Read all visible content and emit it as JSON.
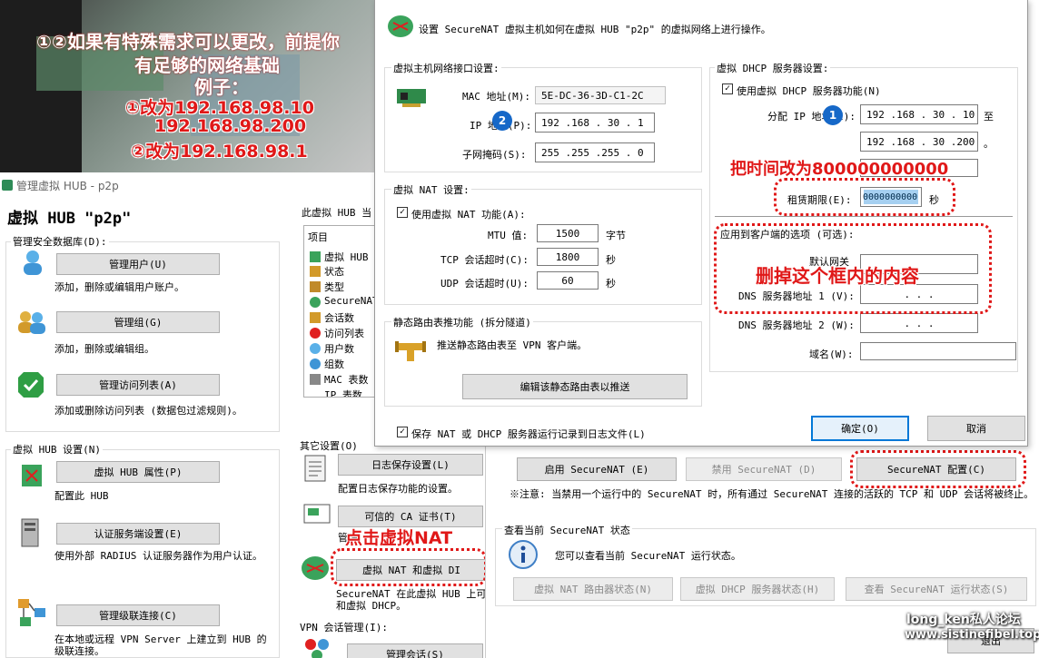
{
  "colors": {
    "accent": "#0078d7",
    "annotation": "#e01818",
    "badge": "#1668c8"
  },
  "overlay": {
    "line1": "①②如果有特殊需求可以更改，前提你",
    "line2": "有足够的网络基础",
    "line3": "例子：",
    "line4": "①改为192.168.98.10",
    "line5": "192.168.98.200",
    "line6": "②改为192.168.98.1"
  },
  "annotations": {
    "lease": "把时间改为800000000000",
    "delete": "删掉这个框内的内容",
    "click_nat": "点击虚拟NAT"
  },
  "badges": {
    "one": "1",
    "two": "2"
  },
  "manager": {
    "window_title": "管理虚拟 HUB - p2p",
    "hub_title": "虚拟 HUB \"p2p\"",
    "db_group": "管理安全数据库(D):",
    "manage_users": "管理用户(U)",
    "manage_users_desc": "添加，删除或编辑用户账户。",
    "manage_groups": "管理组(G)",
    "manage_groups_desc": "添加，删除或编辑组。",
    "manage_acl": "管理访问列表(A)",
    "manage_acl_desc": "添加或删除访问列表 (数据包过滤规则)。",
    "hub_settings_group": "虚拟 HUB 设置(N)",
    "hub_props": "虚拟 HUB 属性(P)",
    "hub_props_desc": "配置此 HUB",
    "auth_server": "认证服务端设置(E)",
    "auth_server_desc": "使用外部 RADIUS 认证服务器作为用户认证。",
    "cascade": "管理级联连接(C)",
    "cascade_desc": "在本地或远程 VPN Server 上建立到 HUB 的级联连接。",
    "status_group": "此虚拟 HUB 当",
    "status_header": "项目",
    "status_items": [
      "虚拟 HUB",
      "状态",
      "类型",
      "SecureNAT",
      "会话数",
      "访问列表",
      "用户数",
      "组数",
      "MAC 表数",
      "IP 表数"
    ],
    "other_group": "其它设置(O)",
    "log_save": "日志保存设置(L)",
    "log_save_desc": "配置日志保存功能的设置。",
    "ca_cert": "可信的 CA 证书(T)",
    "ca_cert_desc": "管理",
    "nat_btn": "虚拟 NAT 和虚拟 DI",
    "nat_desc1": "SecureNAT 在此虚拟 HUB 上可",
    "nat_desc2": "和虚拟 DHCP。",
    "vpn_group": "VPN 会话管理(I):",
    "manage_sessions": "管理会话(S)"
  },
  "nat_panel": {
    "enable": "启用 SecureNAT (E)",
    "disable": "禁用 SecureNAT (D)",
    "config": "SecureNAT 配置(C)",
    "note": "※注意: 当禁用一个运行中的 SecureNAT 时，所有通过 SecureNAT 连接的活跃的 TCP 和 UDP 会话将被终止。",
    "status_group": "查看当前 SecureNAT 状态",
    "status_desc": "您可以查看当前 SecureNAT 运行状态。",
    "nat_router": "虚拟 NAT 路由器状态(N)",
    "dhcp_status": "虚拟 DHCP 服务器状态(H)",
    "run_status": "查看 SecureNAT 运行状态(S)",
    "exit": "退出"
  },
  "dialog": {
    "header": "设置 SecureNAT 虚拟主机如何在虚拟 HUB \"p2p\" 的虚拟网络上进行操作。",
    "iface_group": "虚拟主机网络接口设置:",
    "mac_label": "MAC 地址(M):",
    "mac_value": "5E-DC-36-3D-C1-2C",
    "ip_label": "IP 地址(P):",
    "ip_value": "192 .168 . 30 . 1",
    "mask_label": "子网掩码(S):",
    "mask_value": "255 .255 .255 . 0",
    "nat_group": "虚拟 NAT 设置:",
    "nat_enable": "使用虚拟 NAT 功能(A):",
    "mtu_label": "MTU 值:",
    "mtu_value": "1500",
    "mtu_unit": "字节",
    "tcp_label": "TCP 会话超时(C):",
    "tcp_value": "1800",
    "tcp_unit": "秒",
    "udp_label": "UDP 会话超时(U):",
    "udp_value": "60",
    "udp_unit": "秒",
    "route_group": "静态路由表推功能 (拆分隧道)",
    "route_desc": "推送静态路由表至 VPN 客户端。",
    "route_btn": "编辑该静态路由表以推送",
    "log_chk": "保存 NAT 或 DHCP 服务器运行记录到日志文件(L)",
    "dhcp_group": "虚拟 DHCP 服务器设置:",
    "dhcp_enable": "使用虚拟 DHCP 服务器功能(N)",
    "alloc_label": "分配 IP 地址(I):",
    "alloc_start": "192 .168 . 30 . 10",
    "to": "至",
    "alloc_end": "192 .168 . 30 .200",
    "end_mark": "。",
    "lease_label": "租赁期限(E):",
    "lease_value": "0000000000",
    "lease_unit": "秒",
    "client_group": "应用到客户端的选项 (可选):",
    "gateway_label": "默认网关",
    "dns1_label": "DNS 服务器地址 1 (V):",
    "dns1_value": ".   .   .",
    "dns2_label": "DNS 服务器地址 2 (W):",
    "dns2_value": ".   .   .",
    "domain_label": "域名(W):",
    "ok": "确定(O)",
    "cancel": "取消"
  },
  "watermark": {
    "line1": "long_ken私人论坛",
    "line2": "www.sistinefibel.top"
  }
}
